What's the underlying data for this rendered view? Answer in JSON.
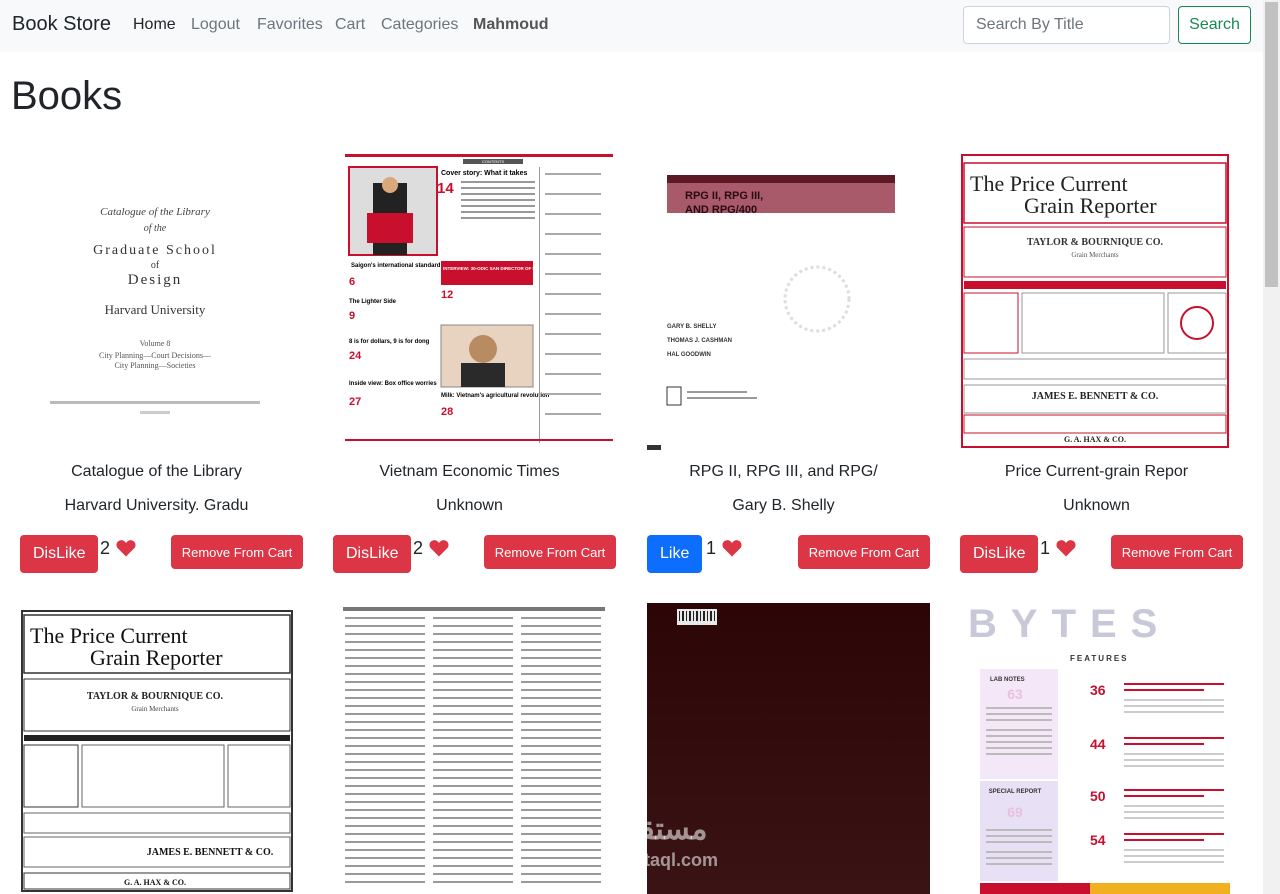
{
  "navbar": {
    "brand": "Book Store",
    "links": [
      "Home",
      "Logout",
      "Favorites",
      "Cart",
      "Categories"
    ],
    "user": "Mahmoud",
    "search_placeholder": "Search By Title",
    "search_button": "Search"
  },
  "page": {
    "title": "Books"
  },
  "books": [
    {
      "title": "Catalogue of the Library",
      "author": "Harvard University. Gradu",
      "like_label": "DisLike",
      "likes": "2",
      "remove_label": "Remove From Cart",
      "cover_text": [
        "Catalogue of the Library",
        "of the",
        "Graduate School",
        "of",
        "Design",
        "Harvard University",
        "Volume 8",
        "City Planning—Court Decisions—",
        "City Planning—Societies"
      ]
    },
    {
      "title": "Vietnam Economic Times",
      "author": "Unknown",
      "like_label": "DisLike",
      "likes": "2",
      "remove_label": "Remove From Cart",
      "cover_text": [
        "CONTENTS",
        "Cover story: What it takes",
        "14",
        "Saigon's international standard office space",
        "6",
        "The Lighter Side",
        "9",
        "8 is for dollars, 9 is for dong",
        "24",
        "Inside view: Box office worries",
        "27",
        "INTERVIEW: 30-ODIC SAN DIRECTOR OF PLANNING & INVESTMENT",
        "12",
        "Milk: Vietnam's agricultural revolution",
        "28"
      ]
    },
    {
      "title": "RPG II, RPG III, and RPG/",
      "author": "Gary B. Shelly",
      "like_label": "Like",
      "likes": "1",
      "remove_label": "Remove From Cart",
      "cover_text": [
        "RPG II, RPG III,",
        "AND RPG/400",
        "GARY B. SHELLY",
        "THOMAS J. CASHMAN",
        "HAL GOODWIN"
      ]
    },
    {
      "title": "Price Current-grain Repor",
      "author": "Unknown",
      "like_label": "DisLike",
      "likes": "1",
      "remove_label": "Remove From Cart",
      "cover_text": [
        "The Price Current",
        "Grain Reporter",
        "TAYLOR & BOURNIQUE CO.",
        "Grain Merchants",
        "JAMES E. BENNETT & CO.",
        "G. A. HAX & CO."
      ]
    },
    {
      "cover_text": [
        "The Price Current",
        "Grain Reporter",
        "TAYLOR & BOURNIQUE CO.",
        "Grain Merchants",
        "JAMES E. BENNETT & CO.",
        "G. A. HAX & CO."
      ]
    },
    {
      "cover_text": []
    },
    {
      "cover_text": []
    },
    {
      "cover_text": [
        "BYTES",
        "FEATURES",
        "LAB NOTES",
        "63",
        "36",
        "44",
        "SPECIAL REPORT",
        "69",
        "50",
        "54"
      ]
    }
  ],
  "watermark": {
    "arabic": "مستقل",
    "latin": "mostaql.com"
  },
  "colors": {
    "danger": "#dc3545",
    "primary": "#0d6efd",
    "success": "#198754",
    "navbar_bg": "#f8f9fa"
  }
}
